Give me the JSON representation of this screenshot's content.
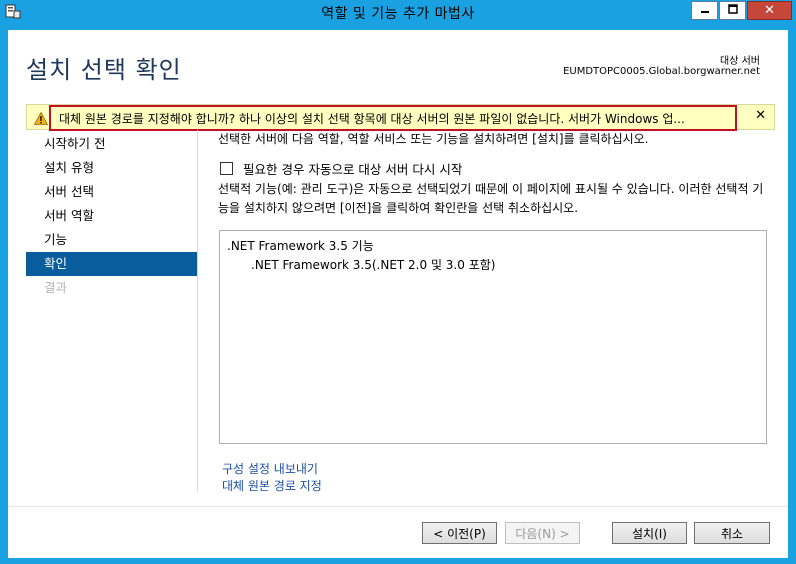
{
  "window": {
    "title": "역할 및 기능 추가 마법사",
    "minimize_icon": "minimize-icon",
    "maximize_icon": "maximize-icon",
    "close_glyph": "✕"
  },
  "header": {
    "page_title": "설치 선택 확인",
    "target_label": "대상 서버",
    "target_value": "EUMDTOPC0005.Global.borgwarner.net"
  },
  "warning": {
    "text": "대체 원본 경로를 지정해야 합니까? 하나 이상의 설치 선택 항목에 대상 서버의 원본 파일이 없습니다. 서버가 Windows 업...",
    "close": "✕",
    "icon": "warning-triangle-icon"
  },
  "nav": {
    "items": [
      {
        "label": "시작하기 전"
      },
      {
        "label": "설치 유형"
      },
      {
        "label": "서버 선택"
      },
      {
        "label": "서버 역할"
      },
      {
        "label": "기능"
      },
      {
        "label": "확인"
      },
      {
        "label": "결과"
      }
    ]
  },
  "content": {
    "description": "선택한 서버에 다음 역할, 역할 서비스 또는 기능을 설치하려면 [설치]를 클릭하십시오.",
    "restart_checkbox": "필요한 경우 자동으로 대상 서버 다시 시작",
    "info_text": "선택적 기능(예: 관리 도구)은 자동으로 선택되었기 때문에 이 페이지에 표시될 수 있습니다. 이러한 선택적 기능을 설치하지 않으려면 [이전]을 클릭하여 확인란을 선택 취소하십시오.",
    "list": [
      {
        "label": ".NET Framework 3.5 기능"
      },
      {
        "label": ".NET Framework 3.5(.NET 2.0 및 3.0 포함)"
      }
    ],
    "export_link": "구성 설정 내보내기",
    "alt_source_link": "대체 원본 경로 지정"
  },
  "buttons": {
    "prev": "< 이전(P)",
    "next": "다음(N) >",
    "install": "설치(I)",
    "cancel": "취소"
  },
  "colors": {
    "titlebar": "#1aa1e1",
    "nav_active": "#0a5d9d",
    "warning_bg": "#ffffc0",
    "highlight": "#c0102a",
    "link": "#1c4fa8"
  }
}
